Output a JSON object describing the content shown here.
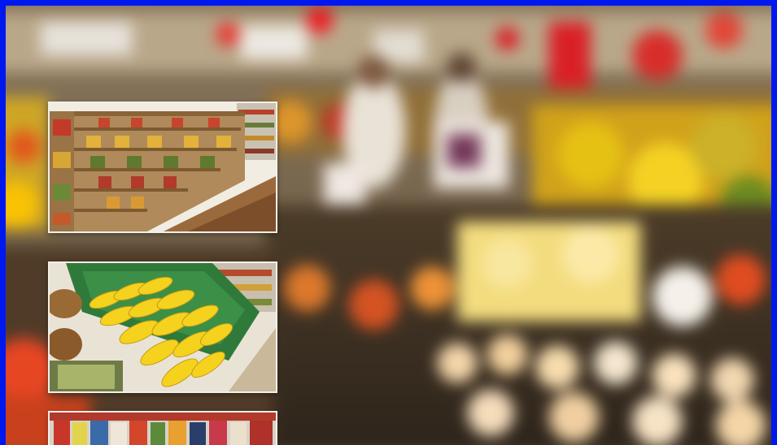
{
  "scene": {
    "description_free": true,
    "accent_border_color": "#0018f0",
    "thumbnail_border_color": "#f2efe9"
  },
  "thumbnails": [
    {
      "name": "grocery-aisle-shelves-thumbnail",
      "icon": "shelf-image"
    },
    {
      "name": "banana-display-thumbnail",
      "icon": "banana-image"
    },
    {
      "name": "newsstand-thumbnail",
      "icon": "magazine-image"
    }
  ]
}
